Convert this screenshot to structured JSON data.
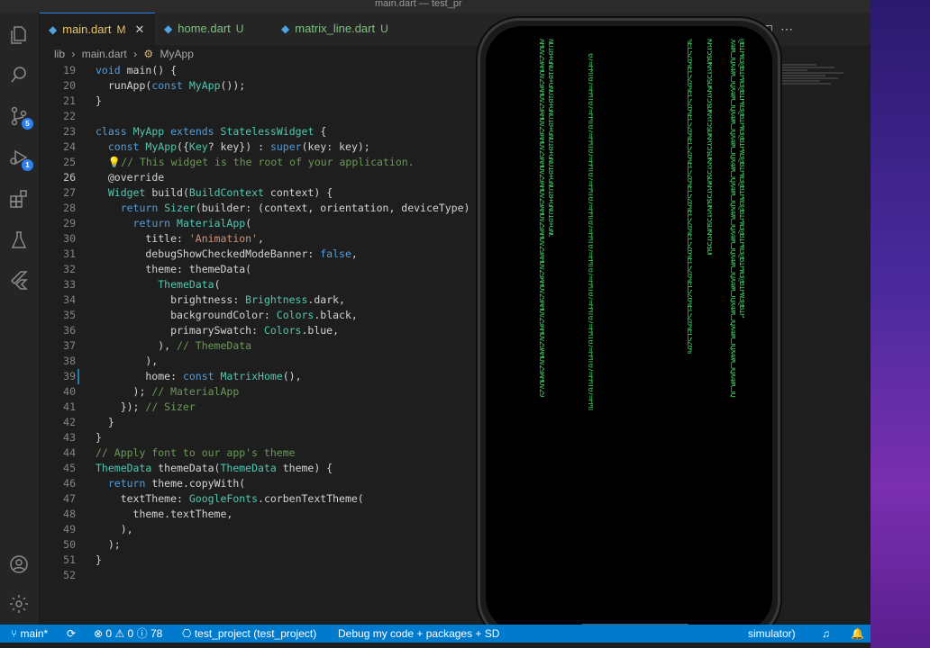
{
  "window": {
    "title": "main.dart — test_pr"
  },
  "colors": {
    "accent": "#007acc",
    "rain": "#34c759",
    "desktop": "#5a2aa0"
  },
  "activity": {
    "icons": [
      "files-icon",
      "search-icon",
      "source-control-icon",
      "run-debug-icon",
      "extensions-icon",
      "testing-icon",
      "flutter-icon",
      "account-icon",
      "settings-gear-icon"
    ],
    "scm_badge": "5",
    "debug_badge": "1"
  },
  "tabs": [
    {
      "label": "main.dart",
      "status": "M"
    },
    {
      "label": "home.dart",
      "status": "U"
    },
    {
      "label": "matrix_line.dart",
      "status": "U"
    }
  ],
  "breadcrumb": {
    "folder": "lib",
    "file": "main.dart",
    "symbol": "MyApp"
  },
  "line_numbers": [
    "19",
    "20",
    "21",
    "22",
    "23",
    "24",
    "25",
    "26",
    "27",
    "28",
    "29",
    "30",
    "31",
    "32",
    "33",
    "34",
    "35",
    "36",
    "37",
    "38",
    "39",
    "40",
    "41",
    "42",
    "43",
    "44",
    "45",
    "46",
    "47",
    "48",
    "49",
    "50",
    "51",
    "52"
  ],
  "current_line": "26",
  "code_lines": [
    "void main() {",
    "  runApp(const MyApp());",
    "}",
    "",
    "class MyApp extends StatelessWidget {",
    "  const MyApp({Key? key}) : super(key: key);",
    "  // This widget is the root of your application.",
    "  @override",
    "  Widget build(BuildContext context) {",
    "    return Sizer(builder: (context, orientation, deviceType) {",
    "      return MaterialApp(",
    "        title: 'Animation',",
    "        debugShowCheckedModeBanner: false,",
    "        theme: themeData(",
    "          ThemeData(",
    "            brightness: Brightness.dark,",
    "            backgroundColor: Colors.black,",
    "            primarySwatch: Colors.blue,",
    "          ), // ThemeData",
    "        ),",
    "        home: const MatrixHome(),",
    "      ); // MaterialApp",
    "    }); // Sizer",
    "  }",
    "}",
    "// Apply font to our app's theme",
    "ThemeData themeData(ThemeData theme) {",
    "  return theme.copyWith(",
    "    textTheme: GoogleFonts.corbenTextTheme(",
    "      theme.textTheme,",
    "    ),",
    "  );",
    "}",
    ""
  ],
  "statusbar": {
    "branch": "main*",
    "errors": "0",
    "warnings": "0",
    "infos": "78",
    "project": "test_project (test_project)",
    "debug": "Debug my code + packages + SD",
    "device": "simulator)"
  }
}
